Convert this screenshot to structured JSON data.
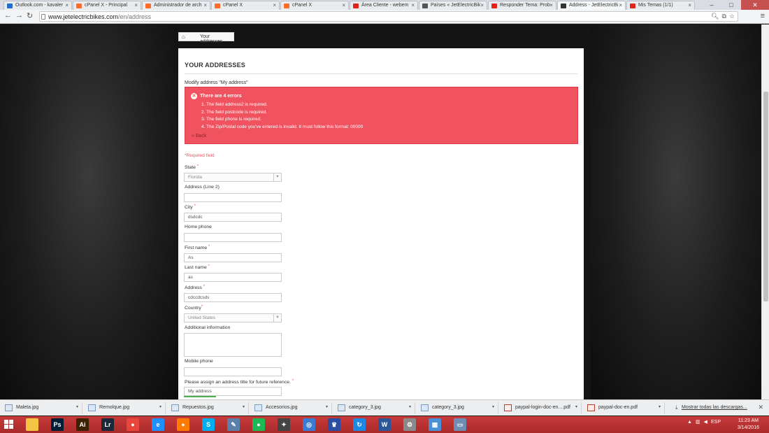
{
  "browser": {
    "tabs": [
      {
        "label": "Outlook.com - kavaler",
        "icon_color": "#1f6fcf"
      },
      {
        "label": "cPanel X - Principal",
        "icon_color": "#ff6c2c"
      },
      {
        "label": "Administrador de arch",
        "icon_color": "#ff6c2c"
      },
      {
        "label": "cPanel X",
        "icon_color": "#ff6c2c"
      },
      {
        "label": "cPanel X",
        "icon_color": "#ff6c2c"
      },
      {
        "label": "Área Cliente - webem",
        "icon_color": "#e2231a"
      },
      {
        "label": "Países « JetElectricBik",
        "icon_color": "#555555"
      },
      {
        "label": "Responder Tema: Prob",
        "icon_color": "#e2231a"
      },
      {
        "label": "Address - JetElectricBi",
        "icon_color": "#333333",
        "active": true
      },
      {
        "label": "Mis Temas (1/1)",
        "icon_color": "#e2231a"
      }
    ],
    "url_domain": "www.jetelectricbikes.com",
    "url_path": "/en/address"
  },
  "breadcrumb": {
    "home_icon": "home-icon",
    "current": "Your addresses"
  },
  "page": {
    "heading": "YOUR ADDRESSES",
    "subtitle": "Modify address \"My address\""
  },
  "alert": {
    "title": "There are 4 errors",
    "errors": [
      "1. The field address2 is required.",
      "2. The field postcode is required.",
      "3. The field phone is required.",
      "4. The Zip/Postal code you've entered is invalid. It must follow this format: 00000"
    ],
    "back_link": "« Back",
    "color": "#f0535f"
  },
  "required_note": "*Required field",
  "form": {
    "state": {
      "label": "State",
      "required": "*",
      "value": "Florida"
    },
    "address2": {
      "label": "Address (Line 2)",
      "value": ""
    },
    "city": {
      "label": "City",
      "required": "*",
      "value": "dsdcdc"
    },
    "home_phone": {
      "label": "Home phone",
      "value": ""
    },
    "first_name": {
      "label": "First name",
      "required": "*",
      "value": "As"
    },
    "last_name": {
      "label": "Last name",
      "required": "*",
      "value": "as"
    },
    "address": {
      "label": "Address",
      "required": "*",
      "value": "cdccdcsds"
    },
    "country": {
      "label": "Country",
      "required": "*",
      "value": "United States"
    },
    "additional_info": {
      "label": "Additional information",
      "value": ""
    },
    "mobile_phone": {
      "label": "Mobile phone",
      "value": ""
    },
    "alias": {
      "label": "Please assign an address title for future reference.",
      "required": "*",
      "value": "My address"
    }
  },
  "downloads": {
    "items": [
      {
        "name": "Maleta.jpg",
        "type": "image"
      },
      {
        "name": "Remolque.jpg",
        "type": "image"
      },
      {
        "name": "Repuestos.jpg",
        "type": "image"
      },
      {
        "name": "Accesorios.jpg",
        "type": "image"
      },
      {
        "name": "category_3.jpg",
        "type": "image"
      },
      {
        "name": "category_3.jpg",
        "type": "image"
      },
      {
        "name": "paypal-login-doc-en....pdf",
        "type": "pdf"
      },
      {
        "name": "paypal-doc-en.pdf",
        "type": "pdf"
      }
    ],
    "show_all": "Mostrar todas las descargas..."
  },
  "taskbar": {
    "apps": [
      {
        "name": "file-explorer-icon",
        "glyph": "",
        "color": "#f4c542"
      },
      {
        "name": "photoshop-icon",
        "glyph": "Ps",
        "color": "#001e36"
      },
      {
        "name": "illustrator-icon",
        "glyph": "Ai",
        "color": "#3a2200"
      },
      {
        "name": "lightroom-icon",
        "glyph": "Lr",
        "color": "#1b2a38"
      },
      {
        "name": "chrome-icon",
        "glyph": "●",
        "color": "#e8453c"
      },
      {
        "name": "internet-explorer-icon",
        "glyph": "e",
        "color": "#1e90ff"
      },
      {
        "name": "firefox-icon",
        "glyph": "●",
        "color": "#ff7a00"
      },
      {
        "name": "skype-icon",
        "glyph": "S",
        "color": "#00aff0"
      },
      {
        "name": "notepad-icon",
        "glyph": "✎",
        "color": "#5a7fa8"
      },
      {
        "name": "spotify-icon",
        "glyph": "●",
        "color": "#1db954"
      },
      {
        "name": "game-icon",
        "glyph": "✦",
        "color": "#444444"
      },
      {
        "name": "sync-icon",
        "glyph": "◎",
        "color": "#3a7bd5"
      },
      {
        "name": "crown-app-icon",
        "glyph": "♛",
        "color": "#2b4ea2"
      },
      {
        "name": "refresh-app-icon",
        "glyph": "↻",
        "color": "#1e88e5"
      },
      {
        "name": "word-icon",
        "glyph": "W",
        "color": "#2b579a"
      },
      {
        "name": "settings-app-icon",
        "glyph": "⚙",
        "color": "#8a8a8a"
      },
      {
        "name": "calculator-icon",
        "glyph": "▦",
        "color": "#4a90d9"
      },
      {
        "name": "window-app-icon",
        "glyph": "▭",
        "color": "#6d8fb3"
      }
    ],
    "language": "ESP",
    "time": "11:23 AM",
    "date": "3/14/2016"
  }
}
